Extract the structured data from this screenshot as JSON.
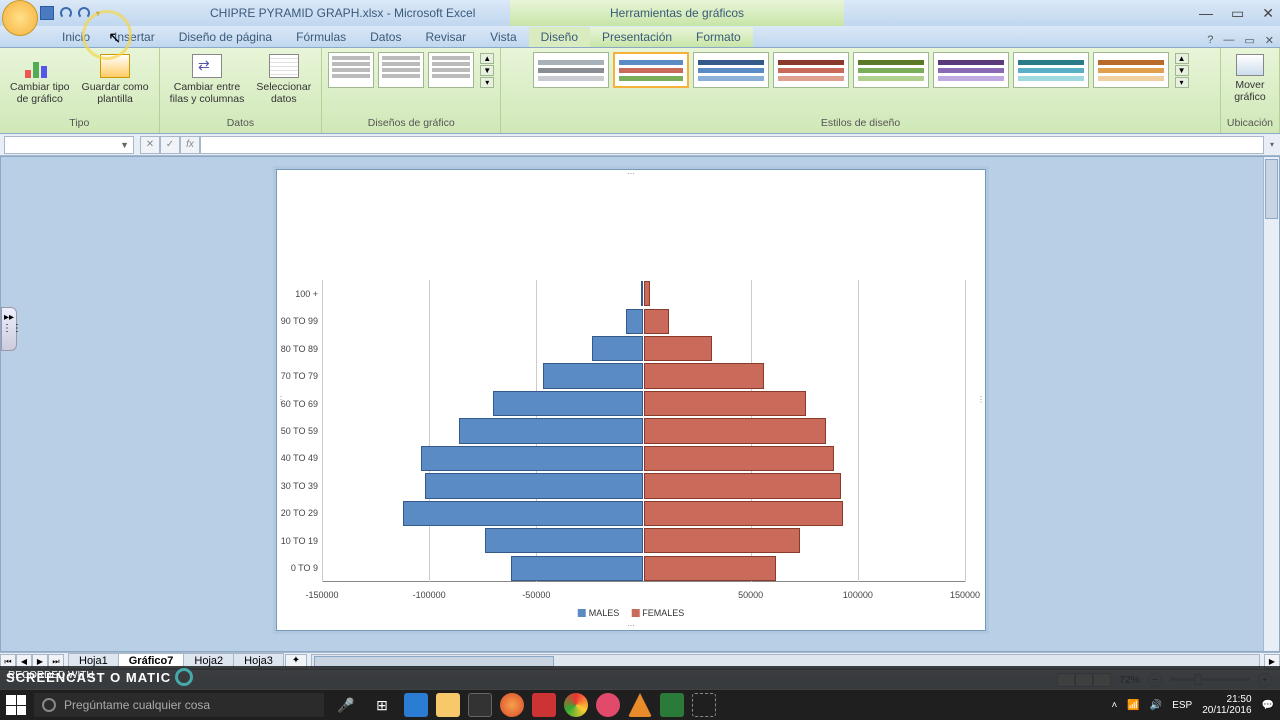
{
  "title": "CHIPRE PYRAMID GRAPH.xlsx - Microsoft Excel",
  "chart_tools_label": "Herramientas de gráficos",
  "window_buttons": {
    "min": "—",
    "max": "▭",
    "close": "✕"
  },
  "ribbon_mini": {
    "help": "?",
    "min": "—",
    "max": "▭",
    "close": "✕"
  },
  "tabs": [
    "Inicio",
    "Insertar",
    "Diseño de página",
    "Fórmulas",
    "Datos",
    "Revisar",
    "Vista"
  ],
  "chart_tabs": [
    "Diseño",
    "Presentación",
    "Formato"
  ],
  "active_tab": "Diseño",
  "ribbon_groups": {
    "tipo": {
      "label": "Tipo",
      "change_type": "Cambiar tipo\nde gráfico",
      "save_template": "Guardar como\nplantilla"
    },
    "datos": {
      "label": "Datos",
      "switch": "Cambiar entre\nfilas y columnas",
      "select": "Seleccionar\ndatos"
    },
    "layouts": {
      "label": "Diseños de gráfico"
    },
    "styles": {
      "label": "Estilos de diseño"
    },
    "location": {
      "label": "Ubicación",
      "move": "Mover\ngráfico"
    }
  },
  "style_palettes": [
    [
      "#a8b0b8",
      "#888e94",
      "#c8ccd0"
    ],
    [
      "#5b8bc5",
      "#c96a5b",
      "#7aae5b"
    ],
    [
      "#335a8a",
      "#5b8bc5",
      "#8ab0d8"
    ],
    [
      "#8a3a2a",
      "#c96a5b",
      "#e0a090"
    ],
    [
      "#5a7a2a",
      "#7aae5b",
      "#b0d090"
    ],
    [
      "#5a3a7a",
      "#8a6ab5",
      "#c0a8e0"
    ],
    [
      "#2a7a8a",
      "#5aaec5",
      "#a0d8e0"
    ],
    [
      "#b86a2a",
      "#e0a050",
      "#f0d0a0"
    ]
  ],
  "active_style_index": 1,
  "name_box_value": "",
  "formula_value": "",
  "sheets": [
    "Hoja1",
    "Gráfico7",
    "Hoja2",
    "Hoja3"
  ],
  "active_sheet": "Gráfico7",
  "statusbar": {
    "left": "",
    "zoom": "72%"
  },
  "watermark_small": "RECORDED WITH",
  "watermark_logo": "SCREENCAST O MATIC",
  "taskbar": {
    "search_placeholder": "Pregúntame cualquier cosa",
    "tray": {
      "lang": "ESP",
      "time": "21:50",
      "date": "20/11/2016"
    }
  },
  "legend": {
    "males": "MALES",
    "females": "FEMALES"
  },
  "chart_data": {
    "type": "bar",
    "orientation": "horizontal-pyramid",
    "title": "",
    "xlabel": "",
    "ylabel": "",
    "xlim": [
      -150000,
      150000
    ],
    "x_ticks": [
      -150000,
      -100000,
      -50000,
      50000,
      100000,
      150000
    ],
    "categories": [
      "0 TO 9",
      "10 TO 19",
      "20 TO 29",
      "30 TO 39",
      "40 TO 49",
      "50 TO 59",
      "60 TO 69",
      "70 TO 79",
      "80 TO 89",
      "90 TO 99",
      "100 +"
    ],
    "series": [
      {
        "name": "MALES",
        "color": "#5b8bc5",
        "values": [
          -62000,
          -74000,
          -112000,
          -102000,
          -104000,
          -86000,
          -70000,
          -47000,
          -24000,
          -8000,
          -1000
        ]
      },
      {
        "name": "FEMALES",
        "color": "#c96a5b",
        "values": [
          62000,
          73000,
          93000,
          92000,
          89000,
          85000,
          76000,
          56000,
          32000,
          12000,
          3000
        ]
      }
    ]
  }
}
